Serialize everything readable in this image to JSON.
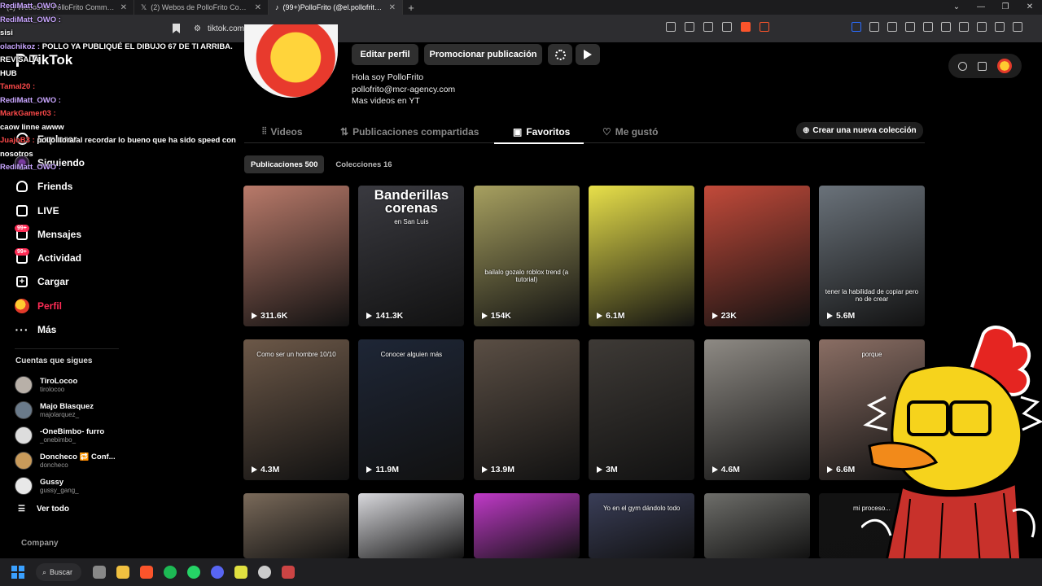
{
  "browser": {
    "tabs": [
      {
        "label": "(1) Webos de PolloFrito Community",
        "active": false
      },
      {
        "label": "(2) Webos de PolloFrito Community",
        "active": false
      },
      {
        "label": "(99+)PolloFrito (@el.pollofrito) |",
        "active": true
      }
    ],
    "url": "tiktok.com/@el.pollofrito"
  },
  "chat": [
    {
      "user": "RediMatt_OWO",
      "msg": "",
      "color": "purple"
    },
    {
      "user": "RediMatt_OWO",
      "msg": "",
      "color": "purple"
    },
    {
      "user": "",
      "msg": "sisi",
      "color": "red"
    },
    {
      "user": "olachikoz",
      "msg": "POLLO YA PUBLIQUÉ EL DIBUJO 67 DE TI ARRIBA. REVÍSALA",
      "color": "purple"
    },
    {
      "user": "",
      "msg": "HUB",
      "color": "white"
    },
    {
      "user": "Tamal20",
      "msg": "",
      "color": "red"
    },
    {
      "user": "RediMatt_OWO",
      "msg": "",
      "color": "purple"
    },
    {
      "user": "MarkGamer03",
      "msg": "",
      "color": "red"
    },
    {
      "user": "",
      "msg": "caow linne awww",
      "color": "white"
    },
    {
      "user": "JuajoB3",
      "msg": "pollo llora al recordar lo bueno que ha sido speed con",
      "color": "red"
    },
    {
      "user": "",
      "msg": "nosotros",
      "color": "white"
    },
    {
      "user": "RediMatt_OWO",
      "msg": "",
      "color": "purple"
    }
  ],
  "sidebar": {
    "logo": "TikTok",
    "nav": [
      {
        "label": "Explorar",
        "icon": "compass-icon"
      },
      {
        "label": "Siguiendo",
        "icon": "following-avatar-icon"
      },
      {
        "label": "Friends",
        "icon": "friends-icon"
      },
      {
        "label": "LIVE",
        "icon": "live-icon"
      },
      {
        "label": "Mensajes",
        "icon": "messages-icon",
        "badge": "99+"
      },
      {
        "label": "Actividad",
        "icon": "activity-icon",
        "badge": "99+"
      },
      {
        "label": "Cargar",
        "icon": "upload-icon"
      },
      {
        "label": "Perfil",
        "icon": "profile-avatar-icon",
        "active": true
      },
      {
        "label": "Más",
        "icon": "more-icon"
      }
    ],
    "following_title": "Cuentas que sigues",
    "following": [
      {
        "name": "TiroLocoo",
        "handle": "tirolocoo"
      },
      {
        "name": "Majo Blasquez",
        "handle": "majolarquez_"
      },
      {
        "name": "-OneBimbo- furro",
        "handle": "_onebimbo_"
      },
      {
        "name": "Doncheco 🔁 Conf...",
        "handle": "doncheco"
      },
      {
        "name": "Gussy",
        "handle": "gussy_gang_"
      }
    ],
    "see_all": "Ver todo",
    "company": "Company"
  },
  "profile": {
    "edit_label": "Editar perfil",
    "promote_label": "Promocionar publicación",
    "bio": [
      "Hola soy PolloFrito",
      "pollofrito@mcr-agency.com",
      "Mas videos en YT"
    ]
  },
  "tabs": {
    "videos": "Videos",
    "reposts": "Publicaciones compartidas",
    "favorites": "Favoritos",
    "liked": "Me gustó",
    "new_collection": "Crear una nueva colección"
  },
  "subtabs": {
    "posts": "Publicaciones 500",
    "collections": "Colecciones 16"
  },
  "videos": [
    {
      "views": "311.6K",
      "caption": "",
      "bg": "#b97a6a"
    },
    {
      "views": "141.3K",
      "caption": "Banderillas corenas",
      "sub": "en San Luis",
      "bg": "#3a3a40"
    },
    {
      "views": "154K",
      "caption": "bailalo gozalo roblox trend (a tutorial)",
      "bg": "#a7a060"
    },
    {
      "views": "6.1M",
      "caption": "",
      "bg": "#e8e04a"
    },
    {
      "views": "23K",
      "caption": "",
      "bg": "#c24a3a"
    },
    {
      "views": "5.6M",
      "caption": "tener la habilidad de copiar pero no de crear",
      "bg": "#6a727a"
    },
    {
      "views": "4.3M",
      "caption": "Como ser un hombre 10/10",
      "bg": "#6c5848"
    },
    {
      "views": "11.9M",
      "caption": "Conocer alguien más",
      "bg": "#1e2636"
    },
    {
      "views": "13.9M",
      "caption": "",
      "bg": "#5a4e44"
    },
    {
      "views": "3M",
      "caption": "",
      "bg": "#3e3a36"
    },
    {
      "views": "4.6M",
      "caption": "",
      "bg": "#8e8a84"
    },
    {
      "views": "6.6M",
      "caption": "porque",
      "bg": "#8a6e64"
    },
    {
      "views": "",
      "caption": "",
      "bg": "#7a6a5a"
    },
    {
      "views": "",
      "caption": "",
      "bg": "#d8d8dc"
    },
    {
      "views": "",
      "caption": "",
      "bg": "#c03ac8"
    },
    {
      "views": "",
      "caption": "Yo en el gym dándolo todo",
      "bg": "#3a3e58"
    },
    {
      "views": "",
      "caption": "",
      "bg": "#6e6e6a"
    },
    {
      "views": "",
      "caption": "mi proceso...",
      "bg": "#121212"
    }
  ],
  "taskbar": {
    "search": "Buscar"
  }
}
